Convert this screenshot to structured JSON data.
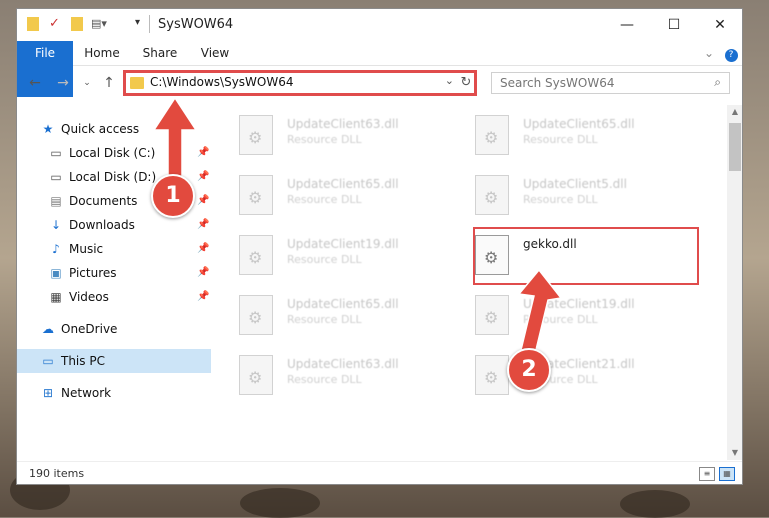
{
  "window": {
    "title": "SysWOW64",
    "controls": {
      "minimize": "—",
      "maximize": "☐",
      "close": "✕"
    }
  },
  "ribbon": {
    "tabs": [
      "File",
      "Home",
      "Share",
      "View"
    ],
    "expand_icon": "chevron-down-icon",
    "help_icon": "help-icon"
  },
  "address_bar": {
    "path": "C:\\Windows\\SysWOW64",
    "dropdown": "⌄",
    "refresh": "↻"
  },
  "search": {
    "placeholder": "Search SysWOW64",
    "icon": "⌕"
  },
  "nav": {
    "quick_access": "Quick access",
    "items": [
      {
        "label": "Local Disk (C:)",
        "icon": "drive-icon",
        "pinned": true
      },
      {
        "label": "Local Disk (D:)",
        "icon": "drive-icon",
        "pinned": true
      },
      {
        "label": "Documents",
        "icon": "documents-icon",
        "pinned": true
      },
      {
        "label": "Downloads",
        "icon": "downloads-icon",
        "pinned": true
      },
      {
        "label": "Music",
        "icon": "music-icon",
        "pinned": true
      },
      {
        "label": "Pictures",
        "icon": "pictures-icon",
        "pinned": true
      },
      {
        "label": "Videos",
        "icon": "videos-icon",
        "pinned": true
      }
    ],
    "onedrive": "OneDrive",
    "this_pc": "This PC",
    "network": "Network"
  },
  "files": [
    {
      "name": "UpdateClient63.dll",
      "type": "Resource DLL"
    },
    {
      "name": "UpdateClient65.dll",
      "type": "Resource DLL"
    },
    {
      "name": "UpdateClient65.dll",
      "type": "Resource DLL"
    },
    {
      "name": "UpdateClient5.dll",
      "type": "Resource DLL"
    },
    {
      "name": "UpdateClient19.dll",
      "type": "Resource DLL"
    },
    {
      "name": "gekko.dll",
      "type": ""
    },
    {
      "name": "UpdateClient65.dll",
      "type": "Resource DLL"
    },
    {
      "name": "UpdateClient19.dll",
      "type": "Resource DLL"
    },
    {
      "name": "UpdateClient63.dll",
      "type": "Resource DLL"
    },
    {
      "name": "UpdateClient21.dll",
      "type": "Resource DLL"
    }
  ],
  "status": {
    "item_count": "190 items"
  },
  "annotations": {
    "step1": "1",
    "step2": "2",
    "color": "#e24a3e"
  }
}
